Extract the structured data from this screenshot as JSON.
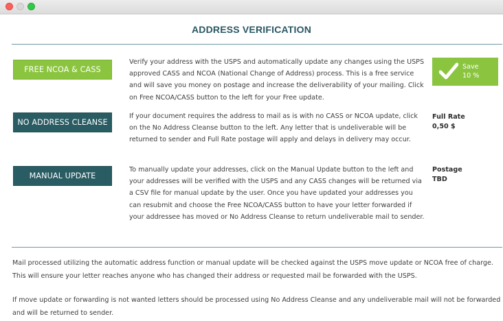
{
  "window": {
    "close_color": "#fc605c",
    "minimize_color": "#d8d8d8",
    "zoom_color": "#34c84a"
  },
  "page": {
    "title": "ADDRESS VERIFICATION"
  },
  "options": [
    {
      "button_label": "FREE NCOA & CASS",
      "button_color": "#8bc53f",
      "description": "Verify your address with the USPS and automatically update any changes using the USPS approved CASS and NCOA (National Change of Address) process. This is a free service and will save you money on postage and increase the deliverability of your mailing. Click on Free NCOA/CASS button to the left for your Free update.",
      "badge": {
        "icon": "checkmark-icon",
        "line1": "Save",
        "line2": "10 %"
      }
    },
    {
      "button_label": "NO ADDRESS CLEANSE",
      "button_color": "#2a5c63",
      "description": "If your document requires the address to mail as is with no CASS or NCOA update, click on the No Address Cleanse button to the left. Any letter that is undeliverable will be returned to sender and Full Rate postage will apply and delays in delivery may occur.",
      "rate_line1": "Full Rate",
      "rate_line2": "0,50 $"
    },
    {
      "button_label": "MANUAL UPDATE",
      "button_color": "#2a5c63",
      "description": "To manually update your addresses, click on the Manual Update button to the left and your addresses will be verified with the USPS and any CASS changes will be returned via a CSV file for manual update by the user. Once you have updated your addresses you can resubmit and choose the Free NCOA/CASS button to have your letter forwarded if your addressee has moved or No Address Cleanse to return undeliverable mail to sender.",
      "rate_line1": "Postage",
      "rate_line2": "TBD"
    }
  ],
  "notes": [
    "Mail processed utilizing the automatic address function or manual update will be checked against the USPS move update or NCOA free of charge. This will ensure your letter reaches anyone who has changed their address or requested mail be forwarded with the USPS.",
    "If move update or forwarding is not wanted letters should be processed using No Address Cleanse and any undeliverable mail will not be forwarded and will be returned to sender."
  ]
}
